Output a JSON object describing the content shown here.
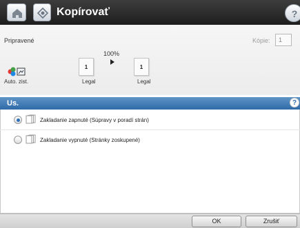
{
  "header": {
    "title": "Kopírovať",
    "home_icon": "home-icon",
    "copy_icon": "copy-icon",
    "help_icon": "help-icon"
  },
  "status": {
    "ready": "Pripravené",
    "copies_label": "Kópie:",
    "copies_value": "1",
    "zoom": "100%",
    "source_pages": "1",
    "output_pages": "1",
    "source_paper": "Legal",
    "output_paper": "Legal",
    "color_mode": "Auto. zist."
  },
  "panel": {
    "title": "Us.",
    "help": "?",
    "options": [
      {
        "label": "Zakladanie zapnuté (Súpravy v poradí strán)",
        "selected": true
      },
      {
        "label": "Zakladanie vypnuté (Stránky zoskupené)",
        "selected": false
      }
    ]
  },
  "footer": {
    "ok": "OK",
    "cancel": "Zrušiť"
  },
  "colors": {
    "accent": "#2f6ba8",
    "header_bg": "#2a2a2a"
  }
}
